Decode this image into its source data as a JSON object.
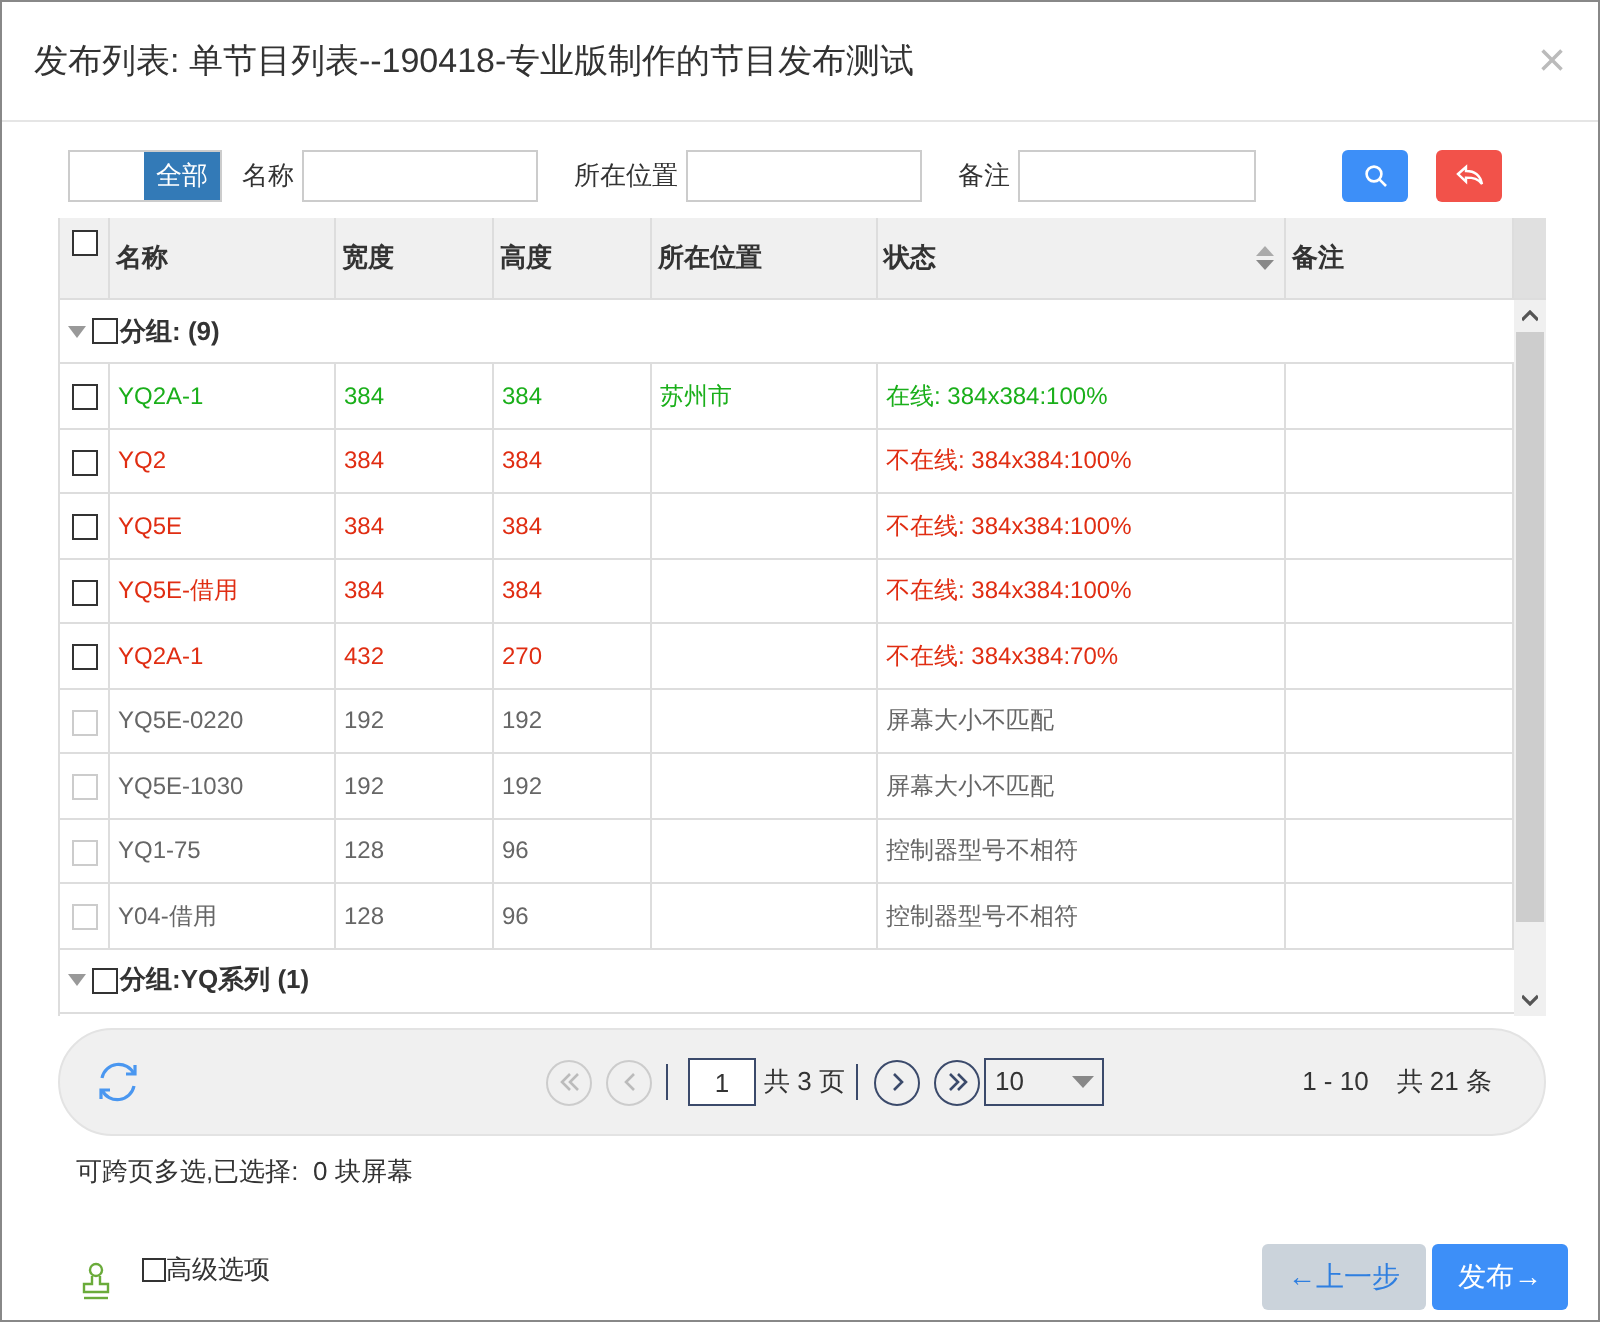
{
  "window": {
    "title": "发布列表: 单节目列表--190418-专业版制作的节目发布测试",
    "close": "×"
  },
  "filter": {
    "toggle": {
      "label": "全部",
      "selected": true
    },
    "fields": [
      {
        "label": "名称"
      },
      {
        "label": "所在位置"
      },
      {
        "label": "备注"
      }
    ]
  },
  "table": {
    "all_checked": false,
    "columns": [
      {
        "label": "名称",
        "sortable": false
      },
      {
        "label": "宽度",
        "sortable": false
      },
      {
        "label": "高度",
        "sortable": false
      },
      {
        "label": "所在位置",
        "sortable": false
      },
      {
        "label": "状态",
        "sortable": true
      },
      {
        "label": "备注",
        "sortable": false
      }
    ],
    "groups": [
      {
        "label": "分组: (9)",
        "expanded": true,
        "checked": false,
        "rows": [
          {
            "kind": "online",
            "checked": false,
            "disabled": false,
            "cells": [
              "YQ2A-1",
              "384",
              "384",
              "苏州市",
              "在线: 384x384:100%",
              ""
            ]
          },
          {
            "kind": "offline",
            "checked": false,
            "disabled": false,
            "cells": [
              "YQ2",
              "384",
              "384",
              "",
              "不在线: 384x384:100%",
              ""
            ]
          },
          {
            "kind": "offline",
            "checked": false,
            "disabled": false,
            "cells": [
              "YQ5E",
              "384",
              "384",
              "",
              "不在线: 384x384:100%",
              ""
            ]
          },
          {
            "kind": "offline",
            "checked": false,
            "disabled": false,
            "cells": [
              "YQ5E-借用",
              "384",
              "384",
              "",
              "不在线: 384x384:100%",
              ""
            ]
          },
          {
            "kind": "offline",
            "checked": false,
            "disabled": false,
            "cells": [
              "YQ2A-1",
              "432",
              "270",
              "",
              "不在线: 384x384:70%",
              ""
            ]
          },
          {
            "kind": "mismatch",
            "checked": false,
            "disabled": true,
            "cells": [
              "YQ5E-0220",
              "192",
              "192",
              "",
              "屏幕大小不匹配",
              ""
            ]
          },
          {
            "kind": "mismatch",
            "checked": false,
            "disabled": true,
            "cells": [
              "YQ5E-1030",
              "192",
              "192",
              "",
              "屏幕大小不匹配",
              ""
            ]
          },
          {
            "kind": "mismatch",
            "checked": false,
            "disabled": true,
            "cells": [
              "YQ1-75",
              "128",
              "96",
              "",
              "控制器型号不相符",
              ""
            ]
          },
          {
            "kind": "mismatch",
            "checked": false,
            "disabled": true,
            "cells": [
              "Y04-借用",
              "128",
              "96",
              "",
              "控制器型号不相符",
              ""
            ]
          }
        ]
      },
      {
        "label": "分组:YQ系列 (1)",
        "expanded": true,
        "checked": false
      }
    ]
  },
  "pager": {
    "page": "1",
    "total_pages": "共 3 页",
    "page_size": "10",
    "range": "1 - 10",
    "total": "共 21 条"
  },
  "selection_note": "可跨页多选,已选择:  0 块屏幕",
  "advanced": {
    "label": "高级选项",
    "checked": false
  },
  "buttons": [
    {
      "label": "←上一步",
      "disabled": true
    },
    {
      "label": "发布→",
      "disabled": false
    }
  ]
}
